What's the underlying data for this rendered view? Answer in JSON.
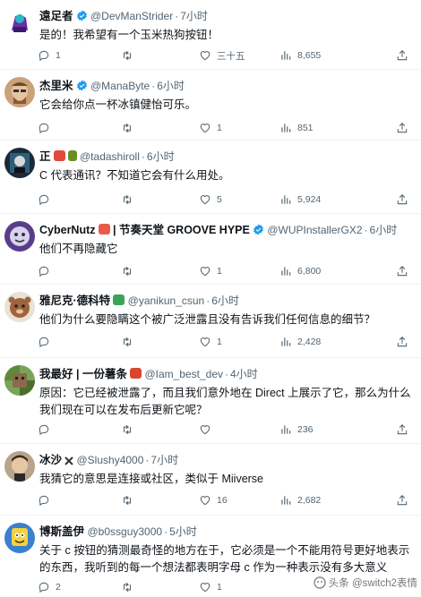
{
  "tweets": [
    {
      "name": "遠足者",
      "handle": "@DevManStrider",
      "time": "7小时",
      "text": "是的！我希望有一个玉米热狗按钮！",
      "reply_count": "1",
      "retweet_count": "",
      "like_count": "三十五",
      "view_count": "8,655"
    },
    {
      "name": "杰里米",
      "handle": "@ManaByte",
      "time": "6小时",
      "text": "它会给你点一杯冰镇健怡可乐。",
      "reply_count": "",
      "retweet_count": "",
      "like_count": "1",
      "view_count": "851"
    },
    {
      "name": "正",
      "handle": "@tadashiroll",
      "time": "6小时",
      "text": "C 代表通讯？不知道它会有什么用处。",
      "reply_count": "",
      "retweet_count": "",
      "like_count": "5",
      "view_count": "5,924"
    },
    {
      "name": "CyberNutz",
      "name_suffix": "| 节奏天堂 GROOVE HYPE",
      "handle": "@WUPInstallerGX2",
      "time": "6小时",
      "text": "他们不再隐藏它",
      "reply_count": "",
      "retweet_count": "",
      "like_count": "1",
      "view_count": "6,800"
    },
    {
      "name": "雅尼克·德科特",
      "handle": "@yanikun_csun",
      "time": "6小时",
      "text": "他们为什么要隐瞒这个被广泛泄露且没有告诉我们任何信息的细节？",
      "reply_count": "",
      "retweet_count": "",
      "like_count": "1",
      "view_count": "2,428"
    },
    {
      "name": "我最好 | 一份薯条",
      "handle": "@Iam_best_dev",
      "time": "4小时",
      "text": "原因：它已经被泄露了，而且我们意外地在 Direct 上展示了它，那么为什么我们现在可以在发布后更新它呢？",
      "reply_count": "",
      "retweet_count": "",
      "like_count": "",
      "view_count": "236"
    },
    {
      "name": "冰沙",
      "handle": "@Slushy4000",
      "time": "7小时",
      "text": "我猜它的意思是连接或社区，类似于 Miiverse",
      "reply_count": "",
      "retweet_count": "",
      "like_count": "16",
      "view_count": "2,682"
    },
    {
      "name": "博斯盖伊",
      "handle": "@b0ssguy3000",
      "time": "5小时",
      "text": "关于 c 按钮的猜测最奇怪的地方在于，它必须是一个不能用符号更好地表示的东西，我听到的每一个想法都表明字母 c 作为一种表示没有多大意义",
      "reply_count": "2",
      "retweet_count": "",
      "like_count": "1",
      "view_count": ""
    }
  ],
  "watermark": "头条 @switch2表情",
  "colors": {
    "verified": "#1d9bf0",
    "secondary_text": "#536471",
    "divider": "#eff3f4"
  },
  "icons": [
    "reply-icon",
    "retweet-icon",
    "like-icon",
    "views-icon",
    "share-icon",
    "verified-badge-icon"
  ]
}
